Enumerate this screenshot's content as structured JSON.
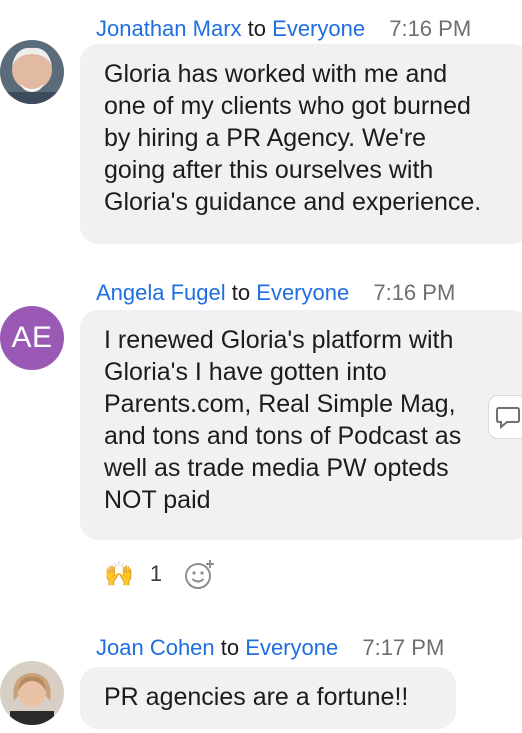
{
  "messages": [
    {
      "sender": "Jonathan Marx",
      "to_word": "to",
      "recipient": "Everyone",
      "time": "7:16 PM",
      "avatar": {
        "type": "photo",
        "color": "#8a8f94"
      },
      "lines": [
        "Gloria has worked with me and",
        "one of my clients who got burned",
        "by hiring a PR Agency.  We're",
        "going after this ourselves with",
        "Gloria's guidance and experience."
      ]
    },
    {
      "sender": "Angela Fugel",
      "to_word": "to",
      "recipient": "Everyone",
      "time": "7:16 PM",
      "avatar": {
        "type": "initials",
        "text": "AE",
        "color": "#9b59b6"
      },
      "lines": [
        "I renewed Gloria's platform with",
        "Gloria's I have gotten into",
        "Parents.com, Real Simple Mag,",
        "and tons and tons of Podcast as",
        "well as trade media PW opteds",
        "NOT paid"
      ],
      "reactions": [
        {
          "emoji": "🙌",
          "count": "1"
        }
      ],
      "add_reaction_icon": "add-reaction-icon",
      "side_action_icon": "reply-icon"
    },
    {
      "sender": "Joan Cohen",
      "to_word": "to",
      "recipient": "Everyone",
      "time": "7:17 PM",
      "avatar": {
        "type": "photo",
        "color": "#c9a27a"
      },
      "lines": [
        "PR agencies are a fortune!!"
      ]
    }
  ],
  "colors": {
    "link": "#1f6fe0",
    "bubble": "#f1f1f3",
    "time": "#6e6e73"
  }
}
